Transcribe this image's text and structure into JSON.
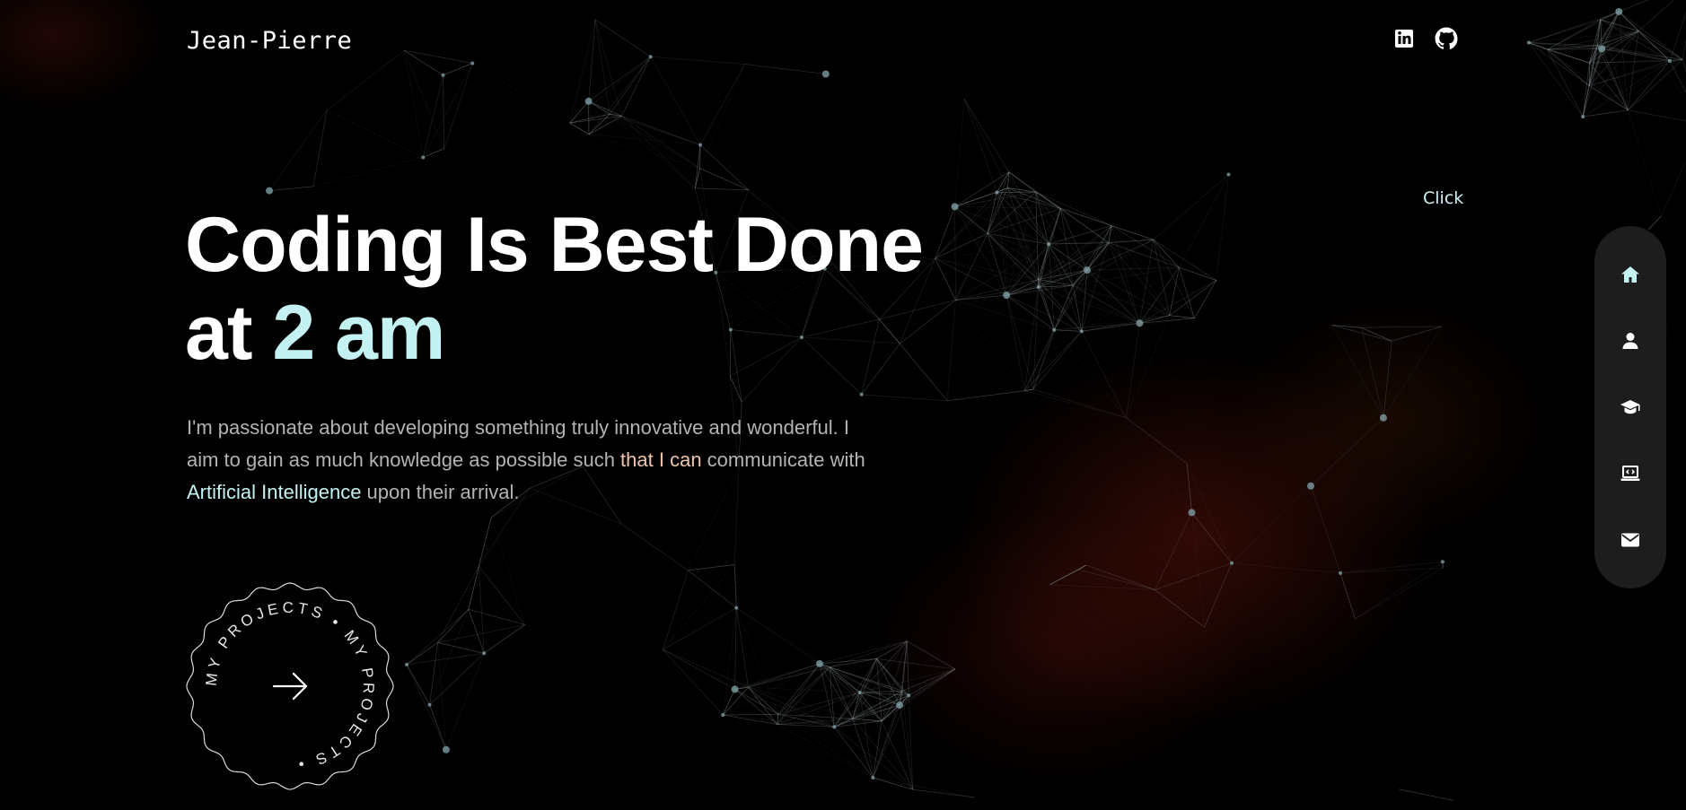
{
  "header": {
    "logo": "Jean-Pierre",
    "social": [
      {
        "name": "linkedin-icon"
      },
      {
        "name": "github-icon"
      }
    ]
  },
  "click_hint": "Click",
  "hero": {
    "title_line1": "Coding Is Best Done",
    "title_at": "at",
    "title_accent": "2 am",
    "desc_part1": "I'm passionate about developing something truly innovative and wonderful. I aim to gain as much knowledge as possible such ",
    "desc_highlight1": "that I can",
    "desc_part2": " communicate with ",
    "desc_highlight2": "Artificial Intelligence",
    "desc_part3": " upon their arrival."
  },
  "projects_button": {
    "circle_text": "MY PROJECTS • MY PROJECTS •",
    "icon": "arrow-right-icon"
  },
  "sidenav": {
    "items": [
      {
        "name": "home",
        "icon": "home-icon",
        "active": true
      },
      {
        "name": "about",
        "icon": "user-icon",
        "active": false
      },
      {
        "name": "education",
        "icon": "graduation-cap-icon",
        "active": false
      },
      {
        "name": "projects",
        "icon": "laptop-code-icon",
        "active": false
      },
      {
        "name": "contact",
        "icon": "envelope-icon",
        "active": false
      }
    ]
  },
  "colors": {
    "background": "#000000",
    "accent": "#c4f1f2",
    "highlight_warm": "#f0c4ab",
    "text_muted": "#b3b3b3",
    "sidenav_bg": "#1d1d1d"
  }
}
